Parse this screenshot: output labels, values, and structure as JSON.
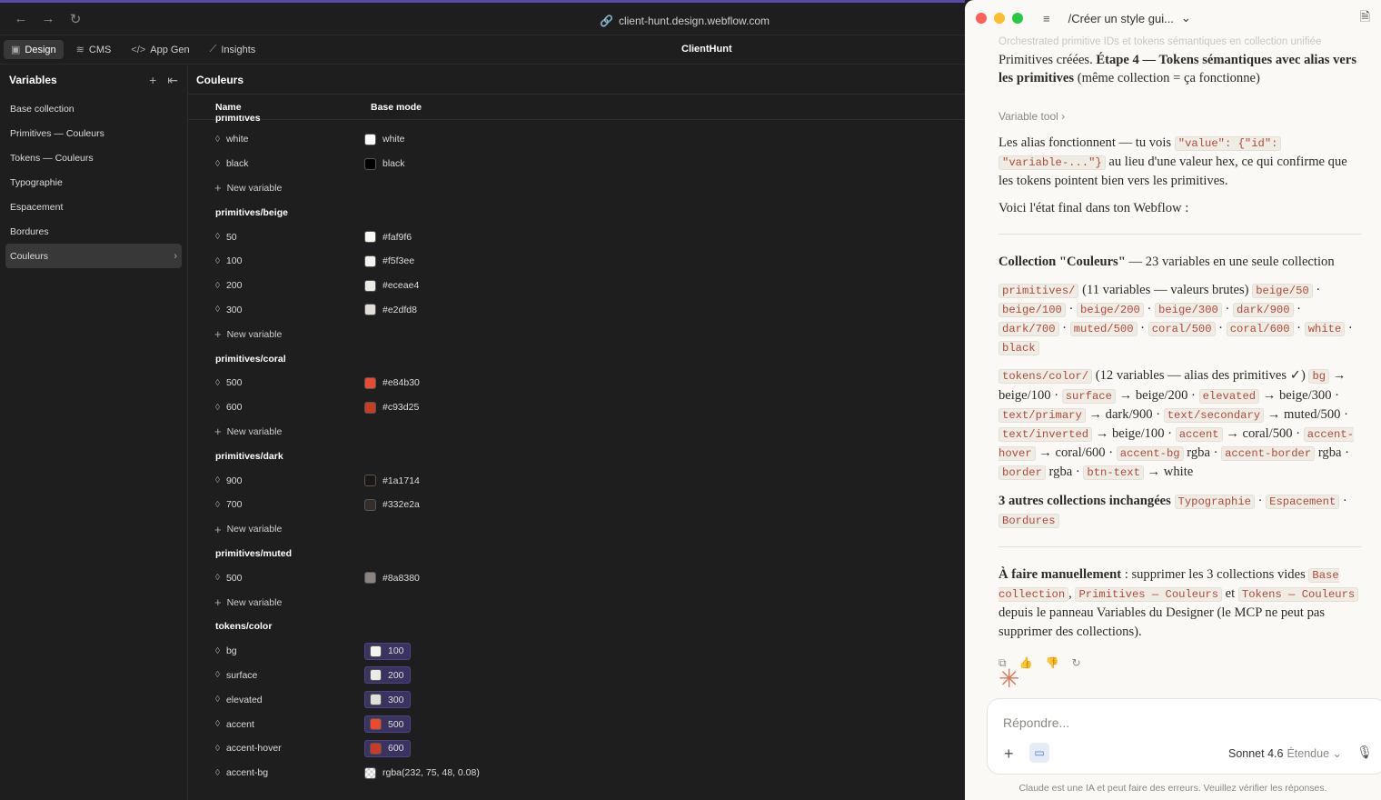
{
  "browser": {
    "url": "client-hunt.design.webflow.com"
  },
  "webflow": {
    "tabs": [
      {
        "label": "Design",
        "icon": "design-icon"
      },
      {
        "label": "CMS",
        "icon": "database-icon"
      },
      {
        "label": "App Gen",
        "icon": "code-icon"
      },
      {
        "label": "Insights",
        "icon": "chart-icon"
      }
    ],
    "site_name": "ClientHunt",
    "sidebar": {
      "title": "Variables",
      "items": [
        {
          "label": "Base collection"
        },
        {
          "label": "Primitives — Couleurs"
        },
        {
          "label": "Tokens — Couleurs"
        },
        {
          "label": "Typographie"
        },
        {
          "label": "Espacement"
        },
        {
          "label": "Bordures"
        },
        {
          "label": "Couleurs"
        }
      ]
    },
    "main": {
      "title": "Couleurs",
      "col_name": "Name",
      "col_mode": "Base mode",
      "clipped_group": "primitives",
      "new_variable_label": "New variable",
      "groups": [
        {
          "rows": [
            {
              "name": "white",
              "value": "white",
              "color": "#ffffff"
            },
            {
              "name": "black",
              "value": "black",
              "color": "#000000"
            }
          ]
        },
        {
          "title": "primitives/beige",
          "rows": [
            {
              "name": "50",
              "value": "#faf9f6",
              "color": "#faf9f6"
            },
            {
              "name": "100",
              "value": "#f5f3ee",
              "color": "#f5f3ee"
            },
            {
              "name": "200",
              "value": "#eceae4",
              "color": "#eceae4"
            },
            {
              "name": "300",
              "value": "#e2dfd8",
              "color": "#e2dfd8"
            }
          ]
        },
        {
          "title": "primitives/coral",
          "rows": [
            {
              "name": "500",
              "value": "#e84b30",
              "color": "#e84b30"
            },
            {
              "name": "600",
              "value": "#c93d25",
              "color": "#c93d25"
            }
          ]
        },
        {
          "title": "primitives/dark",
          "rows": [
            {
              "name": "900",
              "value": "#1a1714",
              "color": "#1a1714"
            },
            {
              "name": "700",
              "value": "#332e2a",
              "color": "#332e2a"
            }
          ]
        },
        {
          "title": "primitives/muted",
          "rows": [
            {
              "name": "500",
              "value": "#8a8380",
              "color": "#8a8380"
            }
          ]
        }
      ],
      "tokens": {
        "title": "tokens/color",
        "rows": [
          {
            "name": "bg",
            "value": "100",
            "color": "#f5f3ee",
            "alias": true
          },
          {
            "name": "surface",
            "value": "200",
            "color": "#eceae4",
            "alias": true
          },
          {
            "name": "elevated",
            "value": "300",
            "color": "#e2dfd8",
            "alias": true
          },
          {
            "name": "accent",
            "value": "500",
            "color": "#e84b30",
            "alias": true
          },
          {
            "name": "accent-hover",
            "value": "600",
            "color": "#c93d25",
            "alias": true
          },
          {
            "name": "accent-bg",
            "value": "rgba(232, 75, 48, 0.08)",
            "color": "checker",
            "alias": false
          }
        ]
      }
    }
  },
  "claude": {
    "title": "/Créer un style gui...",
    "faded_line": "Orchestrated primitive IDs et tokens sémantiques en collection unifiée",
    "p1_lead": "Primitives créées. ",
    "p1_bold": "Étape 4 — Tokens sémantiques avec alias vers les primitives",
    "p1_tail": " (même collection = ça fonctionne)",
    "tool_label": "Variable tool",
    "p2_a": "Les alias fonctionnent — tu vois ",
    "p2_code1": "\"value\": {\"id\":",
    "p2_code2": "\"variable-...\"}",
    "p2_b": " au lieu d'une valeur hex, ce qui confirme que les tokens pointent bien vers les primitives.",
    "p3": "Voici l'état final dans ton Webflow :",
    "coll_bold": "Collection \"Couleurs\"",
    "coll_tail": " — 23 variables en une seule collection",
    "prim_code": "primitives/",
    "prim_text": " (11 variables — valeurs brutes) ",
    "prim_items": [
      "beige/50",
      "beige/100",
      "beige/200",
      "beige/300",
      "dark/900",
      "dark/700",
      "muted/500",
      "coral/500",
      "coral/600",
      "white",
      "black"
    ],
    "tok_code": "tokens/color/",
    "tok_text": " (12 variables — alias des primitives ✓) ",
    "tok_items": [
      {
        "code": "bg",
        "target": "beige/100"
      },
      {
        "code": "surface",
        "target": "beige/200"
      },
      {
        "code": "elevated",
        "target": "beige/300"
      },
      {
        "code": "text/primary",
        "target": "dark/900"
      },
      {
        "code": "text/secondary",
        "target": "muted/500"
      },
      {
        "code": "text/inverted",
        "target": "beige/100"
      },
      {
        "code": "accent",
        "target": "coral/500"
      },
      {
        "code": "accent-hover",
        "target": "coral/600"
      },
      {
        "code": "accent-bg",
        "target": "rgba"
      },
      {
        "code": "accent-border",
        "target": "rgba"
      },
      {
        "code": "border",
        "target": "rgba"
      },
      {
        "code": "btn-text",
        "target": "white"
      }
    ],
    "other_bold": "3 autres collections inchangées",
    "other_items": [
      "Typographie",
      "Espacement",
      "Bordures"
    ],
    "manual_bold": "À faire manuellement",
    "manual_a": " : supprimer les 3 collections vides ",
    "manual_c1": "Base collection",
    "manual_c2": "Primitives — Couleurs",
    "manual_et": " et ",
    "manual_c3": "Tokens — Couleurs",
    "manual_b": " depuis le panneau Variables du Designer (le MCP ne peut pas supprimer des collections).",
    "composer_placeholder": "Répondre...",
    "model": "Sonnet 4.6",
    "mode": "Étendue",
    "disclaimer": "Claude est une IA et peut faire des erreurs. Veuillez vérifier les réponses."
  }
}
